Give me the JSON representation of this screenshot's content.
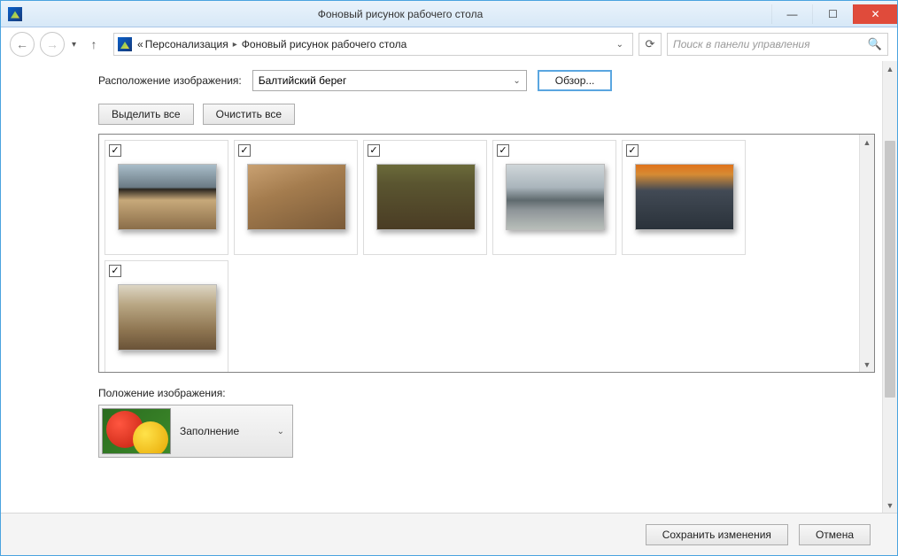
{
  "window": {
    "title": "Фоновый рисунок рабочего стола"
  },
  "breadcrumb": {
    "prefix": "«",
    "item1": "Персонализация",
    "item2": "Фоновый рисунок рабочего стола"
  },
  "search": {
    "placeholder": "Поиск в панели управления"
  },
  "location": {
    "label": "Расположение изображения:",
    "selected": "Балтийский берег",
    "browse": "Обзор..."
  },
  "buttons": {
    "select_all": "Выделить все",
    "clear_all": "Очистить все",
    "save": "Сохранить изменения",
    "cancel": "Отмена"
  },
  "gallery": {
    "items": [
      {
        "checked": true,
        "thumb_class": "t1"
      },
      {
        "checked": true,
        "thumb_class": "t2"
      },
      {
        "checked": true,
        "thumb_class": "t3"
      },
      {
        "checked": true,
        "thumb_class": "t4"
      },
      {
        "checked": true,
        "thumb_class": "t5"
      },
      {
        "checked": true,
        "thumb_class": "t6"
      }
    ]
  },
  "position": {
    "label": "Положение изображения:",
    "selected": "Заполнение"
  }
}
